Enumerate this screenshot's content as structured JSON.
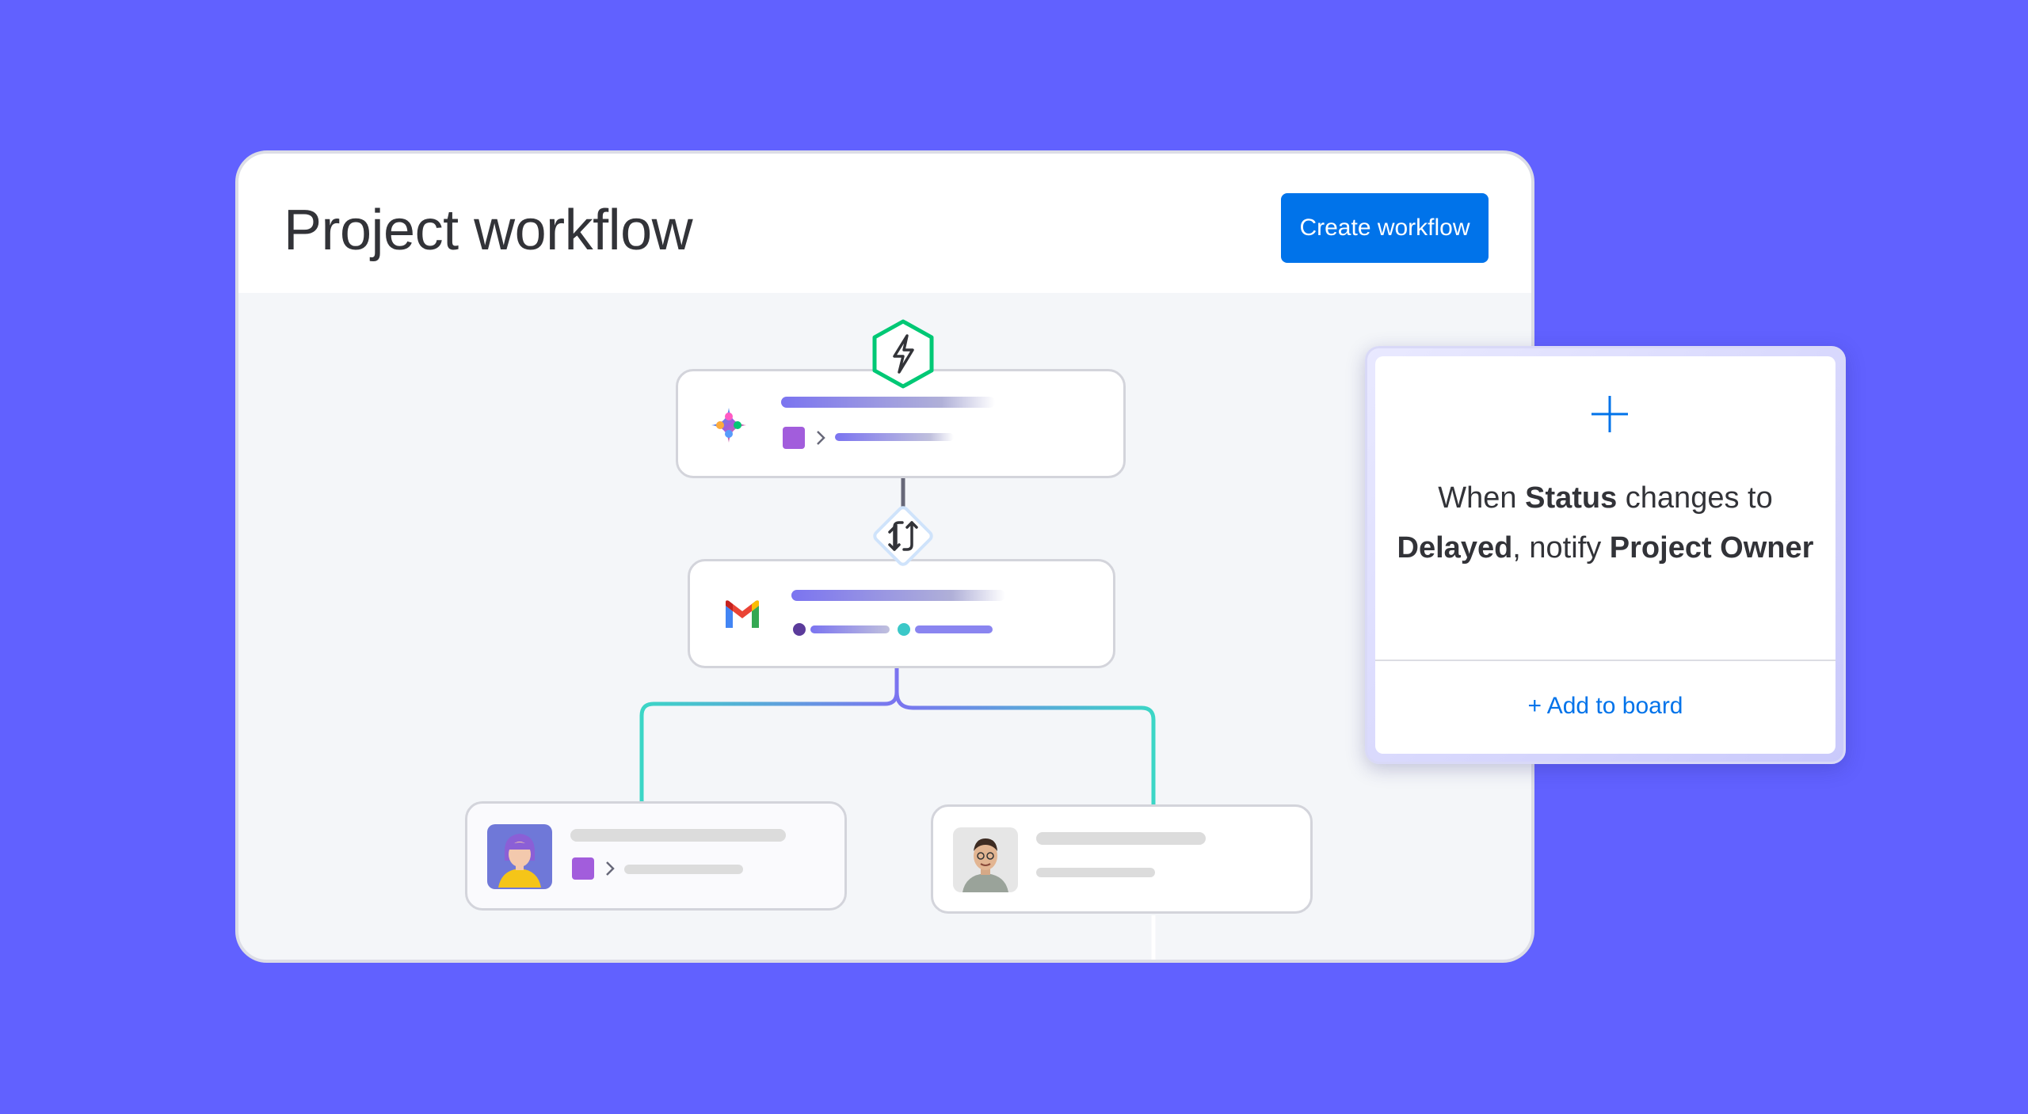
{
  "window": {
    "title": "Project workflow",
    "create_button_label": "Create workflow"
  },
  "workflow": {
    "trigger_icon": "lightning-icon",
    "nodes": [
      {
        "id": "ai-step",
        "icon": "ai-sparkle-icon"
      },
      {
        "id": "gmail-step",
        "icon": "gmail-icon",
        "connector_icon": "swap-arrows-icon"
      },
      {
        "id": "assignee-1",
        "icon": "avatar-woman"
      },
      {
        "id": "assignee-2",
        "icon": "avatar-man"
      }
    ]
  },
  "panel": {
    "plus_icon": "plus-icon",
    "text_parts": [
      "When ",
      "Status",
      " changes to ",
      "Delayed",
      ", notify ",
      "Project Owner"
    ],
    "add_link": "+ Add to board"
  },
  "colors": {
    "background": "#6161ff",
    "accent": "#0073ea",
    "trigger_green": "#00c875"
  }
}
